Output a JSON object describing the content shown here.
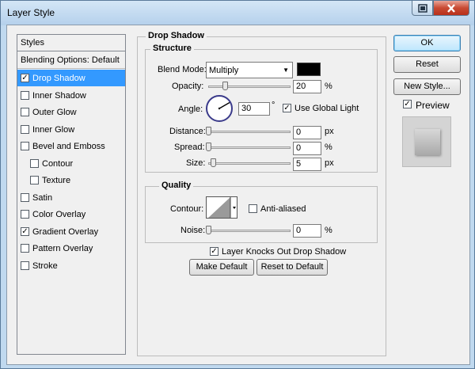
{
  "window": {
    "title": "Layer Style",
    "help_icon": "help-icon",
    "close_icon": "close-icon"
  },
  "styles_list": {
    "header": "Styles",
    "items": [
      {
        "label": "Blending Options: Default",
        "checkbox": false
      },
      {
        "label": "Drop Shadow",
        "checkbox": true,
        "checked": true,
        "selected": true
      },
      {
        "label": "Inner Shadow",
        "checkbox": true,
        "checked": false
      },
      {
        "label": "Outer Glow",
        "checkbox": true,
        "checked": false
      },
      {
        "label": "Inner Glow",
        "checkbox": true,
        "checked": false
      },
      {
        "label": "Bevel and Emboss",
        "checkbox": true,
        "checked": false
      },
      {
        "label": "Contour",
        "checkbox": true,
        "checked": false,
        "indent": true
      },
      {
        "label": "Texture",
        "checkbox": true,
        "checked": false,
        "indent": true
      },
      {
        "label": "Satin",
        "checkbox": true,
        "checked": false
      },
      {
        "label": "Color Overlay",
        "checkbox": true,
        "checked": false
      },
      {
        "label": "Gradient Overlay",
        "checkbox": true,
        "checked": true
      },
      {
        "label": "Pattern Overlay",
        "checkbox": true,
        "checked": false
      },
      {
        "label": "Stroke",
        "checkbox": true,
        "checked": false
      }
    ]
  },
  "drop_shadow": {
    "title": "Drop Shadow",
    "structure": {
      "title": "Structure",
      "blend_mode_label": "Blend Mode:",
      "blend_mode_value": "Multiply",
      "shadow_color": "#000000",
      "opacity_label": "Opacity:",
      "opacity_value": "20",
      "opacity_unit": "%",
      "angle_label": "Angle:",
      "angle_value": "30",
      "angle_unit": "°",
      "use_global_light_label": "Use Global Light",
      "use_global_light_checked": true,
      "distance_label": "Distance:",
      "distance_value": "0",
      "distance_unit": "px",
      "spread_label": "Spread:",
      "spread_value": "0",
      "spread_unit": "%",
      "size_label": "Size:",
      "size_value": "5",
      "size_unit": "px"
    },
    "quality": {
      "title": "Quality",
      "contour_label": "Contour:",
      "anti_aliased_label": "Anti-aliased",
      "anti_aliased_checked": false,
      "noise_label": "Noise:",
      "noise_value": "0",
      "noise_unit": "%"
    },
    "layer_knocks_out_label": "Layer Knocks Out Drop Shadow",
    "layer_knocks_out_checked": true,
    "make_default_label": "Make Default",
    "reset_default_label": "Reset to Default"
  },
  "actions": {
    "ok_label": "OK",
    "reset_label": "Reset",
    "new_style_label": "New Style...",
    "preview_label": "Preview",
    "preview_checked": true
  }
}
